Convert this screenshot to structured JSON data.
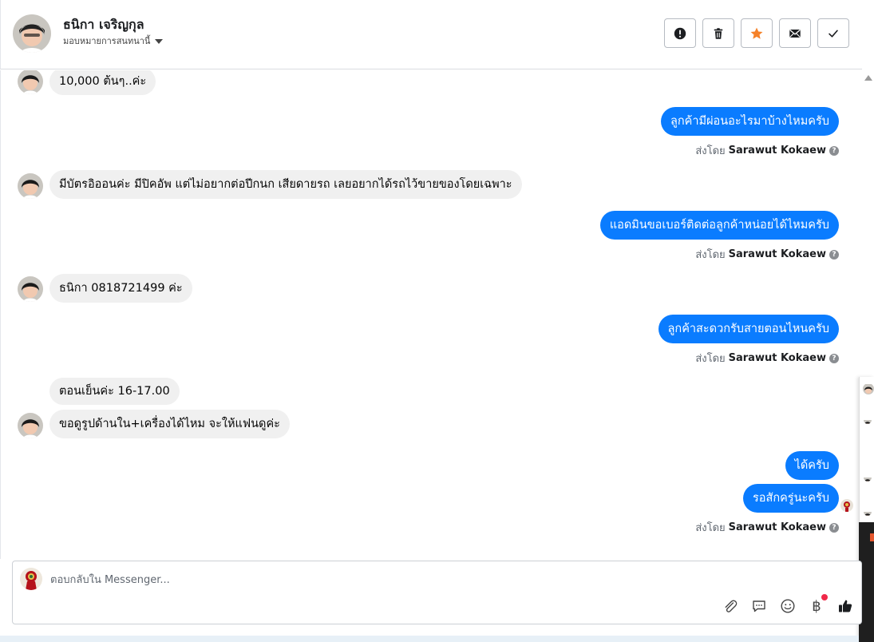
{
  "header": {
    "name": "ธนิกา เจริญกุล",
    "assign_label": "มอบหมายการสนทนานี้",
    "toolbar": [
      {
        "name": "spam-button",
        "icon": "exclamation-circle-icon"
      },
      {
        "name": "delete-button",
        "icon": "trash-icon"
      },
      {
        "name": "star-button",
        "icon": "star-icon"
      },
      {
        "name": "mark-unread-button",
        "icon": "envelope-icon"
      },
      {
        "name": "mark-done-button",
        "icon": "check-icon"
      }
    ]
  },
  "messages": [
    {
      "dir": "in",
      "text": "10,000 ต้นๆ..ค่ะ",
      "avatar": true
    },
    {
      "dir": "out",
      "text": "ลูกค้ามีผ่อนอะไรมาบ้างไหมครับ"
    },
    {
      "dir": "sent_by",
      "prefix": "ส่งโดย",
      "agent": "Sarawut Kokaew"
    },
    {
      "dir": "in",
      "text": "มีบัตรอิออนค่ะ  มีปิคอัพ แต่ไม่อยากต่อปีกนก เสียดายรถ เลยอยากได้รถไว้ขายของโดยเฉพาะ",
      "avatar": true
    },
    {
      "dir": "out",
      "text": "แอดมินขอเบอร์ติดต่อลูกค้าหน่อยได้ไหมครับ"
    },
    {
      "dir": "sent_by",
      "prefix": "ส่งโดย",
      "agent": "Sarawut Kokaew"
    },
    {
      "dir": "in",
      "text": "ธนิกา 0818721499 ค่ะ",
      "avatar": true
    },
    {
      "dir": "out",
      "text": "ลูกค้าสะดวกรับสายตอนไหนครับ"
    },
    {
      "dir": "sent_by",
      "prefix": "ส่งโดย",
      "agent": "Sarawut Kokaew"
    },
    {
      "dir": "in",
      "text": "ตอนเย็นค่ะ 16-17.00",
      "avatar": false
    },
    {
      "dir": "in",
      "text": "ขอดูรูปด้านใน+เครื่องได้ไหม  จะให้แฟนดูค่ะ",
      "avatar": true
    },
    {
      "dir": "out",
      "text": "ได้ครับ"
    },
    {
      "dir": "out",
      "text": "รอสักครู่นะครับ"
    },
    {
      "dir": "sent_by",
      "prefix": "ส่งโดย",
      "agent": "Sarawut Kokaew"
    }
  ],
  "composer": {
    "placeholder": "ตอบกลับใน Messenger...",
    "tools": [
      "paperclip-icon",
      "saved-replies-icon",
      "emoji-icon",
      "baht-payment-icon",
      "like-icon"
    ],
    "baht_symbol": "฿"
  },
  "colors": {
    "outgoing_bubble": "#0a7cff",
    "incoming_bubble": "#f0f0f0",
    "star": "#f5822a",
    "notification_dot": "#f02849"
  }
}
